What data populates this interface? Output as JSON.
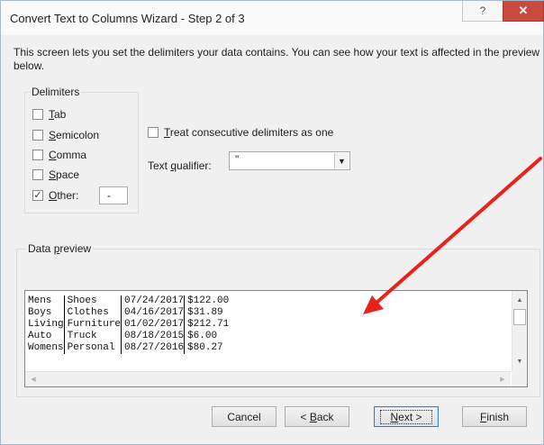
{
  "window": {
    "title": "Convert Text to Columns Wizard - Step 2 of 3",
    "help_glyph": "?",
    "close_glyph": "✕"
  },
  "description": "This screen lets you set the delimiters your data contains.  You can see how your text is affected in the preview below.",
  "delimiters": {
    "group_label": "Delimiters",
    "items": [
      {
        "pre": "",
        "key": "T",
        "post": "ab",
        "checked": false
      },
      {
        "pre": "",
        "key": "S",
        "post": "emicolon",
        "checked": false
      },
      {
        "pre": "",
        "key": "C",
        "post": "omma",
        "checked": false
      },
      {
        "pre": "",
        "key": "S",
        "post": "pace",
        "checked": false
      },
      {
        "pre": "",
        "key": "O",
        "post": "ther:",
        "checked": true
      }
    ],
    "other_value": "-",
    "check_glyph": "✓"
  },
  "consecutive": {
    "pre": "",
    "key": "T",
    "post": "reat consecutive delimiters as one",
    "checked": false
  },
  "qualifier": {
    "pre": "Text ",
    "key": "q",
    "post": "ualifier:",
    "value": "\"",
    "arrow_glyph": "▼"
  },
  "preview": {
    "group_pre": "Data ",
    "group_key": "p",
    "group_post": "review",
    "rows": [
      [
        "Mens",
        "Shoes",
        "07/24/2017",
        "$122.00"
      ],
      [
        "Boys",
        "Clothes",
        "04/16/2017",
        "$31.89"
      ],
      [
        "Living",
        "Furniture",
        "01/02/2017",
        "$212.71"
      ],
      [
        "Auto",
        "Truck",
        "08/18/2015",
        "$6.00"
      ],
      [
        "Womens",
        "Personal",
        "08/27/2016",
        "$80.27"
      ]
    ],
    "scroll_up": "▲",
    "scroll_down": "▼",
    "scroll_left": "◀",
    "scroll_right": "▶"
  },
  "buttons": {
    "cancel": {
      "pre": "Cancel",
      "key": "",
      "post": ""
    },
    "back": {
      "pre": "< ",
      "key": "B",
      "post": "ack"
    },
    "next": {
      "pre": "",
      "key": "N",
      "post": "ext >"
    },
    "finish": {
      "pre": "",
      "key": "F",
      "post": "inish"
    }
  },
  "colors": {
    "annotation_arrow": "#e8231b",
    "window_border": "#aab8cc",
    "close_button": "#c94a3e"
  }
}
